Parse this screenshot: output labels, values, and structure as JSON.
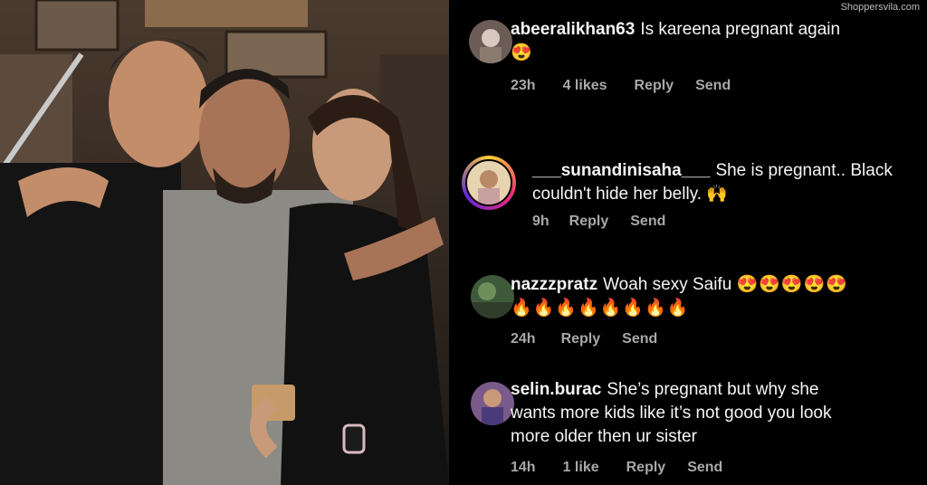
{
  "site": {
    "watermark": "Shoppersvila.com"
  },
  "comments": [
    {
      "username": "abeeralikhan63",
      "text": "Is kareena pregnant again",
      "emoji": "😍",
      "time": "23h",
      "likes": "4 likes",
      "reply": "Reply",
      "send": "Send"
    },
    {
      "username": "___sunandinisaha___",
      "text": "She is pregnant.. Black",
      "text2": "couldn't hide her belly. 🙌",
      "time": "9h",
      "reply": "Reply",
      "send": "Send"
    },
    {
      "username": "nazzzpratz",
      "text": "Woah sexy Saifu",
      "emoji_inline": "😍😍😍😍😍",
      "emoji_row": "🔥🔥🔥🔥🔥🔥🔥🔥",
      "time": "24h",
      "reply": "Reply",
      "send": "Send"
    },
    {
      "username": "selin.burac",
      "text": "She’s pregnant but why she",
      "text2": "wants more kids like it’s not good you look",
      "text3": "more older then ur sister",
      "time": "14h",
      "likes": "1 like",
      "reply": "Reply",
      "send": "Send"
    }
  ],
  "colors": {
    "background": "#000000",
    "meta_text": "#a8a8a8",
    "story_ring": "#ee2a7b"
  },
  "icons": {
    "avatar": "user-avatar-icon"
  }
}
